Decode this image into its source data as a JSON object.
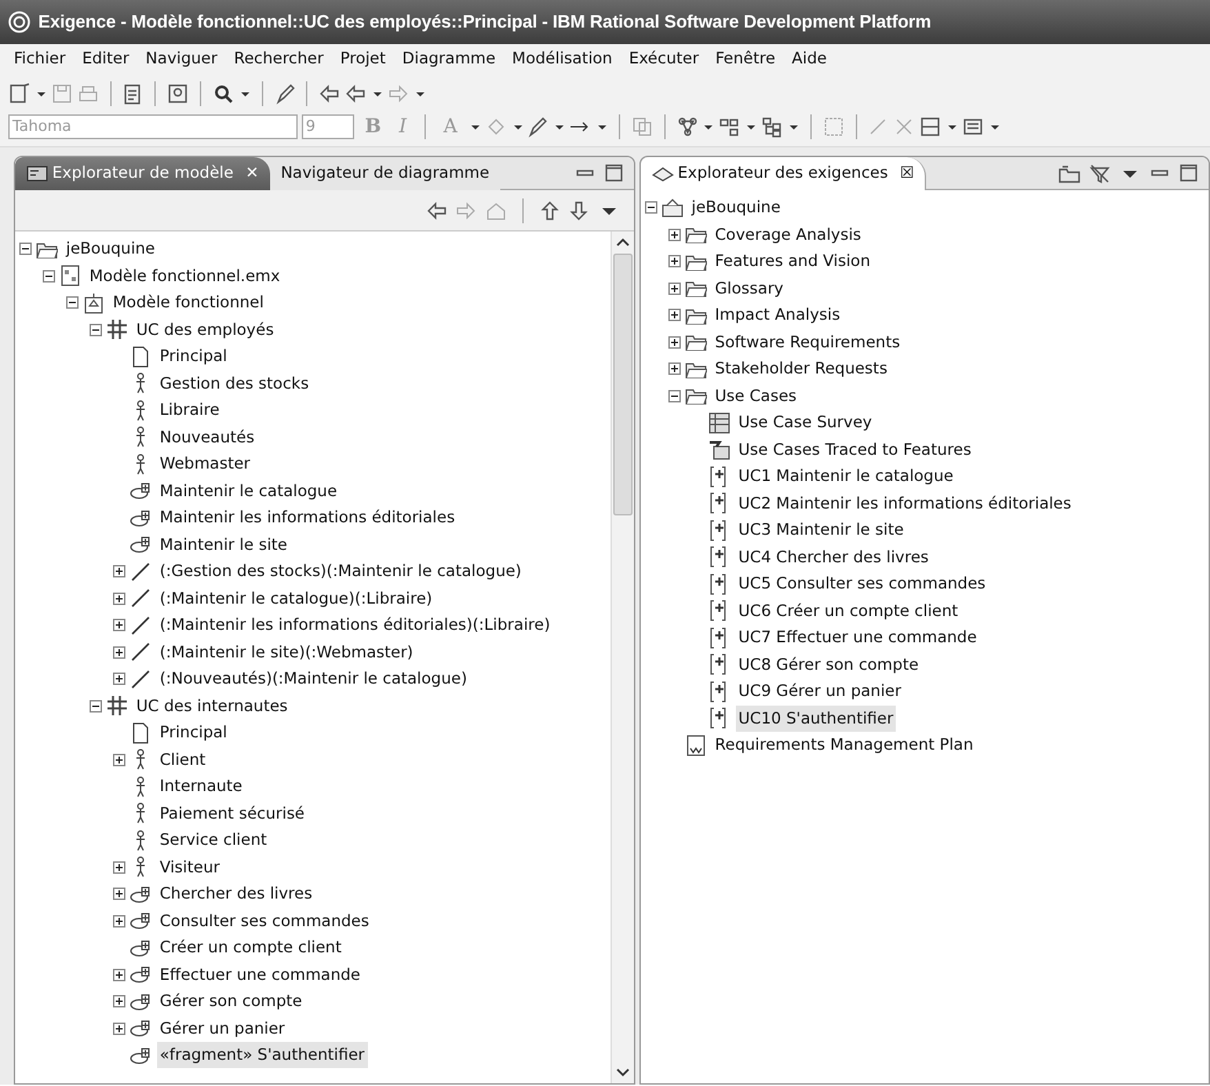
{
  "window": {
    "title": "Exigence - Modèle fonctionnel::UC des employés::Principal - IBM Rational Software Development Platform"
  },
  "menu": [
    "Fichier",
    "Editer",
    "Naviguer",
    "Rechercher",
    "Projet",
    "Diagramme",
    "Modélisation",
    "Exécuter",
    "Fenêtre",
    "Aide"
  ],
  "format_toolbar": {
    "font_name": "Tahoma",
    "font_size": "9",
    "buttons": [
      "B",
      "I",
      "A"
    ]
  },
  "left_panel": {
    "tabs": [
      {
        "label": "Explorateur de modèle",
        "selected": true,
        "close": "✕"
      },
      {
        "label": "Navigateur de diagramme",
        "selected": false
      }
    ],
    "tree": [
      {
        "kind": "folder",
        "label": "jeBouquine",
        "expanded": true,
        "selected": false,
        "children": [
          {
            "kind": "model-file",
            "label": "Modèle fonctionnel.emx",
            "expanded": true,
            "selected": false,
            "children": [
              {
                "kind": "model",
                "label": "Modèle fonctionnel",
                "expanded": true,
                "selected": false,
                "children": [
                  {
                    "kind": "package",
                    "label": "UC des employés",
                    "expanded": true,
                    "selected": false,
                    "children": [
                      {
                        "kind": "diagram",
                        "label": "Principal",
                        "selected": false
                      },
                      {
                        "kind": "actor",
                        "label": "Gestion des stocks",
                        "selected": false
                      },
                      {
                        "kind": "actor",
                        "label": "Libraire",
                        "selected": false
                      },
                      {
                        "kind": "actor",
                        "label": "Nouveautés",
                        "selected": false
                      },
                      {
                        "kind": "actor",
                        "label": "Webmaster",
                        "selected": false
                      },
                      {
                        "kind": "usecase",
                        "label": "Maintenir le catalogue",
                        "selected": false
                      },
                      {
                        "kind": "usecase",
                        "label": "Maintenir les informations éditoriales",
                        "selected": false
                      },
                      {
                        "kind": "usecase",
                        "label": "Maintenir le site",
                        "selected": false
                      },
                      {
                        "kind": "association",
                        "label": "(:Gestion des stocks)(:Maintenir le catalogue)",
                        "expanded": false,
                        "selected": false
                      },
                      {
                        "kind": "association",
                        "label": "(:Maintenir le catalogue)(:Libraire)",
                        "expanded": false,
                        "selected": false
                      },
                      {
                        "kind": "association",
                        "label": "(:Maintenir les informations éditoriales)(:Libraire)",
                        "expanded": false,
                        "selected": false
                      },
                      {
                        "kind": "association",
                        "label": "(:Maintenir le site)(:Webmaster)",
                        "expanded": false,
                        "selected": false
                      },
                      {
                        "kind": "association",
                        "label": "(:Nouveautés)(:Maintenir le catalogue)",
                        "expanded": false,
                        "selected": false
                      }
                    ]
                  },
                  {
                    "kind": "package",
                    "label": "UC des internautes",
                    "expanded": true,
                    "selected": false,
                    "children": [
                      {
                        "kind": "diagram",
                        "label": "Principal",
                        "selected": false
                      },
                      {
                        "kind": "actor",
                        "label": "Client",
                        "expanded": false,
                        "selected": false
                      },
                      {
                        "kind": "actor",
                        "label": "Internaute",
                        "selected": false
                      },
                      {
                        "kind": "actor",
                        "label": "Paiement sécurisé",
                        "selected": false
                      },
                      {
                        "kind": "actor",
                        "label": "Service client",
                        "selected": false
                      },
                      {
                        "kind": "actor",
                        "label": "Visiteur",
                        "expanded": false,
                        "selected": false
                      },
                      {
                        "kind": "usecase",
                        "label": "Chercher des livres",
                        "expanded": false,
                        "selected": false
                      },
                      {
                        "kind": "usecase",
                        "label": "Consulter ses commandes",
                        "expanded": false,
                        "selected": false
                      },
                      {
                        "kind": "usecase",
                        "label": "Créer un compte client",
                        "selected": false
                      },
                      {
                        "kind": "usecase",
                        "label": "Effectuer une commande",
                        "expanded": false,
                        "selected": false
                      },
                      {
                        "kind": "usecase",
                        "label": "Gérer son compte",
                        "expanded": false,
                        "selected": false
                      },
                      {
                        "kind": "usecase",
                        "label": "Gérer un panier",
                        "expanded": false,
                        "selected": false
                      },
                      {
                        "kind": "usecase",
                        "label": "«fragment» S'authentifier",
                        "selected": true
                      }
                    ]
                  }
                ]
              }
            ]
          }
        ]
      }
    ]
  },
  "right_panel": {
    "tabs": [
      {
        "label": "Explorateur des exigences",
        "selected": true,
        "close": "☒"
      }
    ],
    "tree": [
      {
        "kind": "req-project",
        "label": "jeBouquine",
        "expanded": true,
        "selected": false,
        "children": [
          {
            "kind": "folder",
            "label": "Coverage Analysis",
            "expanded": false,
            "selected": false
          },
          {
            "kind": "folder",
            "label": "Features and Vision",
            "expanded": false,
            "selected": false
          },
          {
            "kind": "folder",
            "label": "Glossary",
            "expanded": false,
            "selected": false
          },
          {
            "kind": "folder",
            "label": "Impact Analysis",
            "expanded": false,
            "selected": false
          },
          {
            "kind": "folder",
            "label": "Software Requirements",
            "expanded": false,
            "selected": false
          },
          {
            "kind": "folder",
            "label": "Stakeholder Requests",
            "expanded": false,
            "selected": false
          },
          {
            "kind": "folder",
            "label": "Use Cases",
            "expanded": true,
            "selected": false,
            "children": [
              {
                "kind": "table-view",
                "label": "Use Case Survey",
                "selected": false
              },
              {
                "kind": "trace-view",
                "label": "Use Cases Traced to Features",
                "selected": false
              },
              {
                "kind": "requirement",
                "label": "UC1 Maintenir le catalogue",
                "selected": false
              },
              {
                "kind": "requirement",
                "label": "UC2 Maintenir les informations éditoriales",
                "selected": false
              },
              {
                "kind": "requirement",
                "label": "UC3 Maintenir le site",
                "selected": false
              },
              {
                "kind": "requirement",
                "label": "UC4 Chercher des livres",
                "selected": false
              },
              {
                "kind": "requirement",
                "label": "UC5 Consulter ses commandes",
                "selected": false
              },
              {
                "kind": "requirement",
                "label": "UC6 Créer un compte client",
                "selected": false
              },
              {
                "kind": "requirement",
                "label": "UC7 Effectuer une commande",
                "selected": false
              },
              {
                "kind": "requirement",
                "label": "UC8 Gérer son compte",
                "selected": false
              },
              {
                "kind": "requirement",
                "label": "UC9 Gérer un panier",
                "selected": false
              },
              {
                "kind": "requirement",
                "label": "UC10 S'authentifier",
                "selected": true
              }
            ]
          },
          {
            "kind": "document",
            "label": "Requirements Management Plan",
            "selected": false
          }
        ]
      }
    ]
  }
}
